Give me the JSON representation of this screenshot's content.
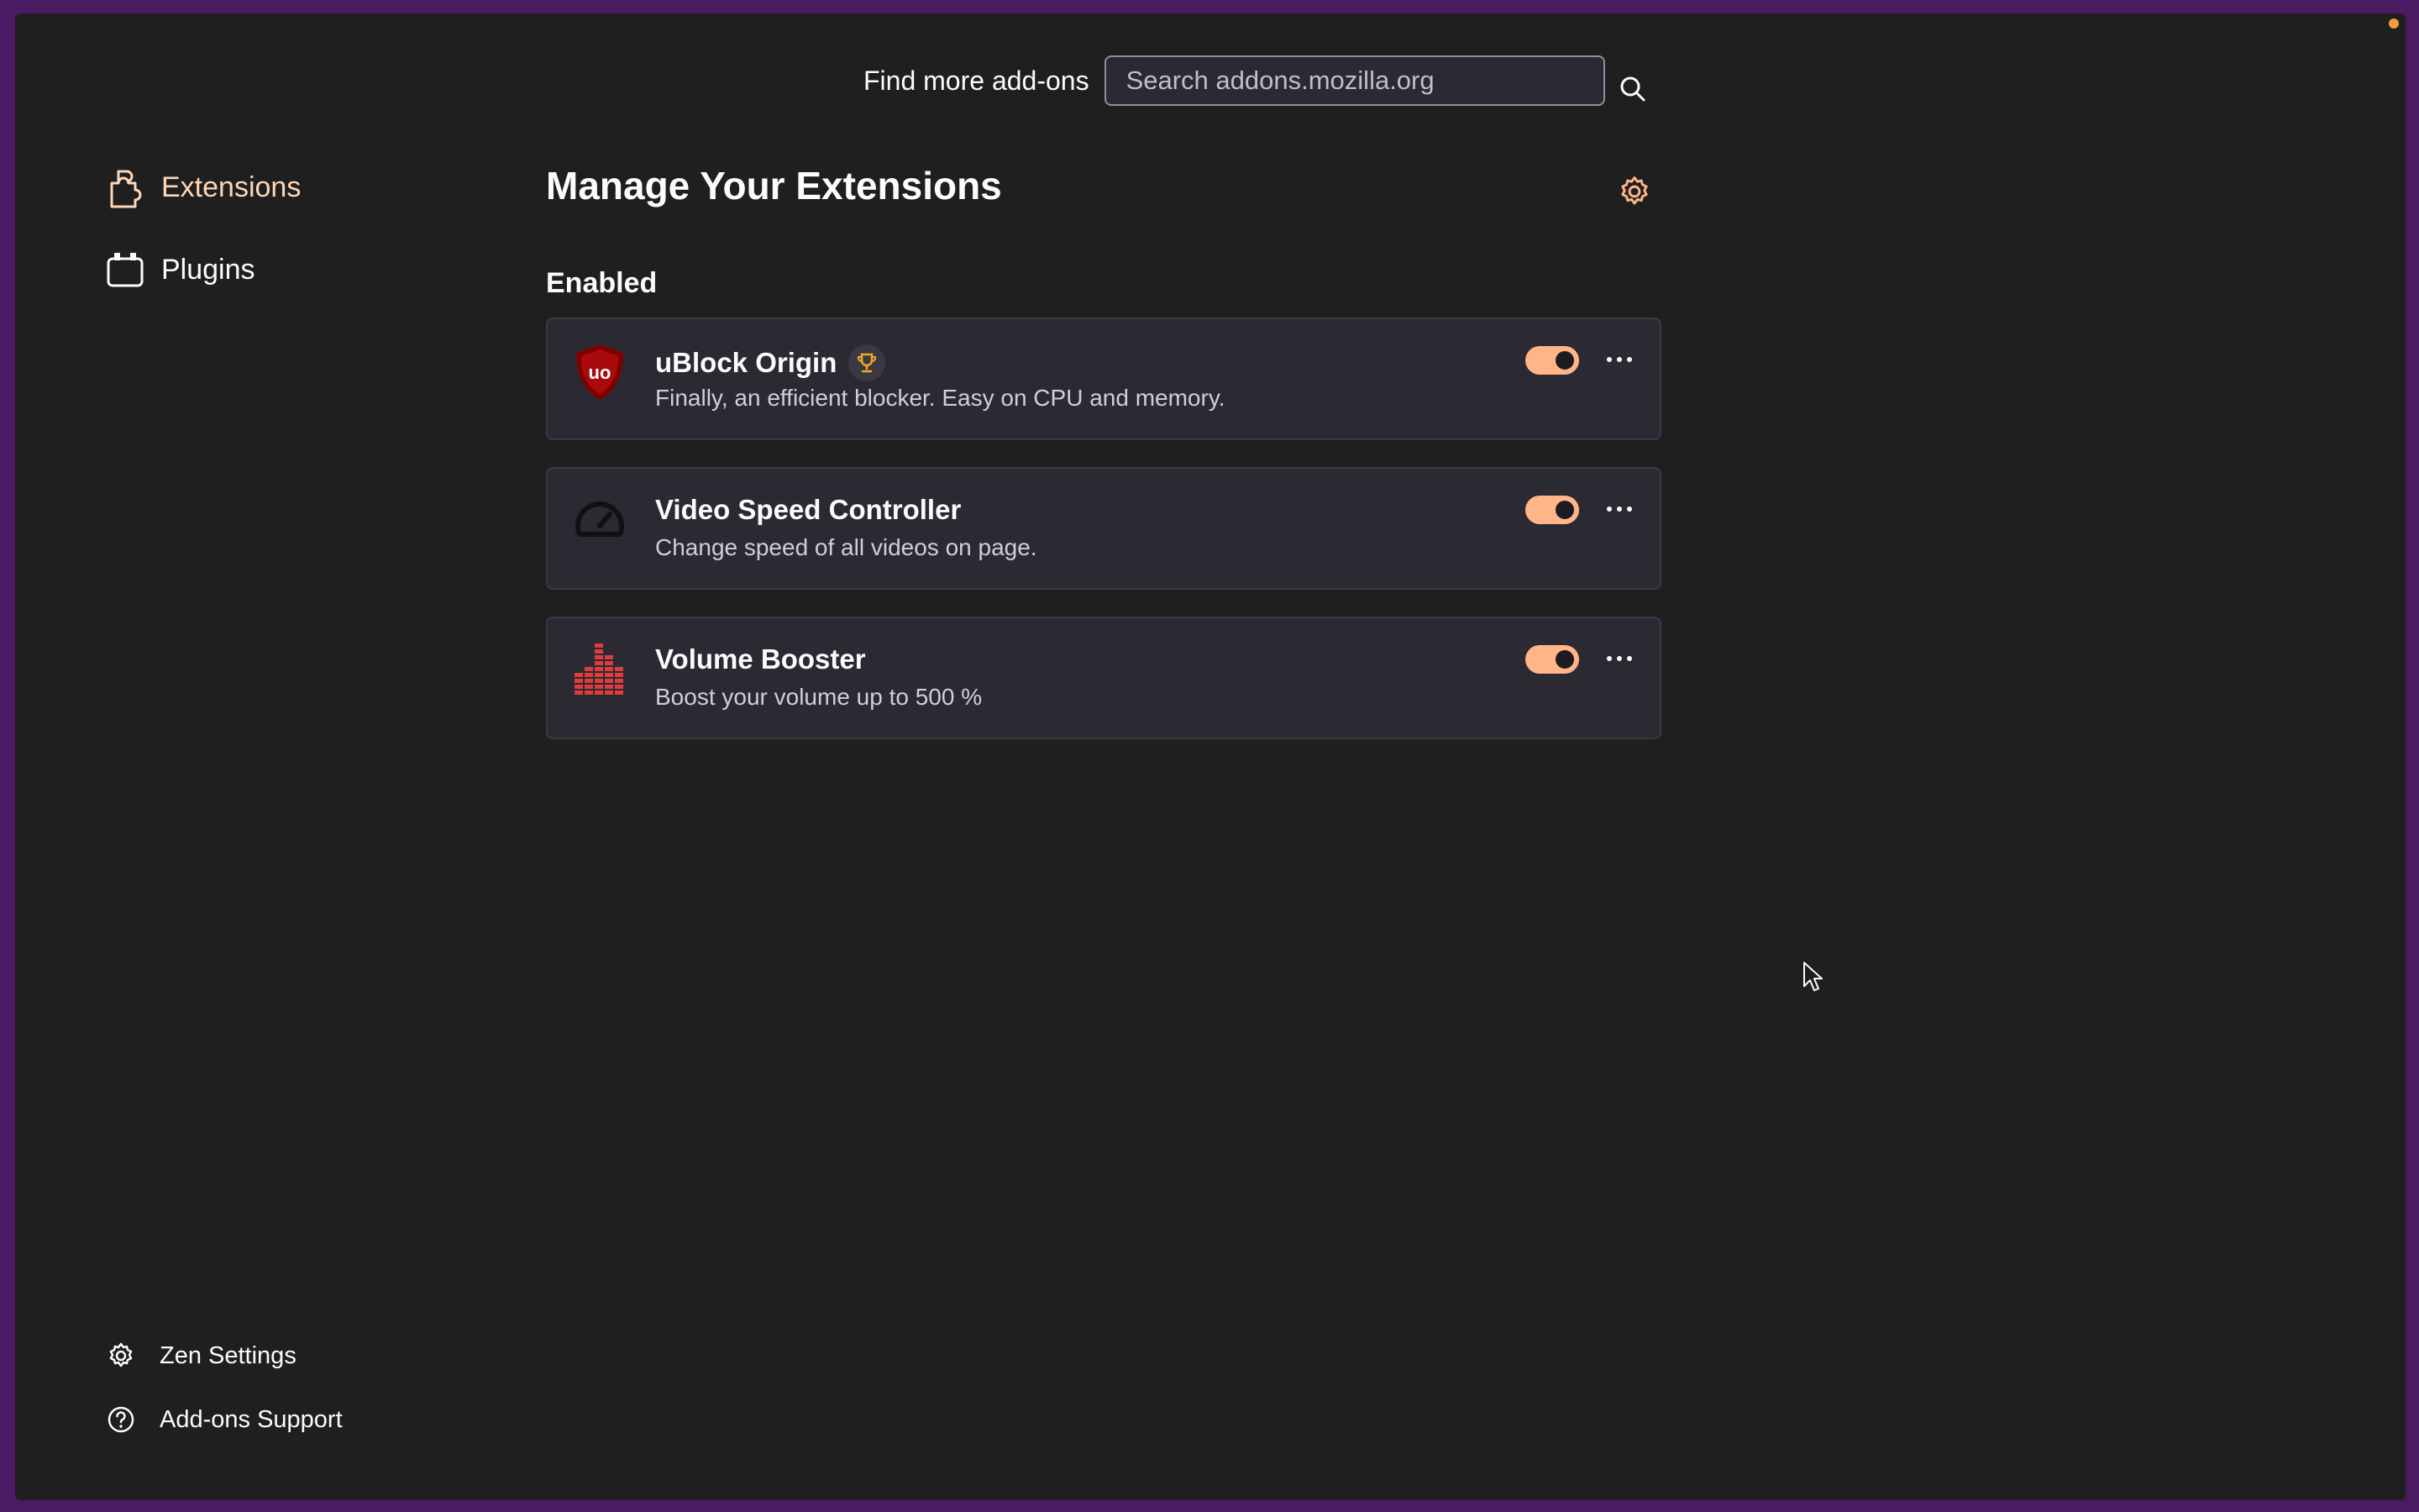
{
  "header": {
    "find_label": "Find more add-ons",
    "search_placeholder": "Search addons.mozilla.org"
  },
  "sidebar": {
    "items": [
      {
        "label": "Extensions",
        "icon": "puzzle-icon",
        "selected": true
      },
      {
        "label": "Plugins",
        "icon": "plugin-icon",
        "selected": false
      }
    ],
    "footer": [
      {
        "label": "Zen Settings",
        "icon": "gear-icon"
      },
      {
        "label": "Add-ons Support",
        "icon": "help-icon"
      }
    ]
  },
  "main": {
    "title": "Manage Your Extensions",
    "section": "Enabled",
    "extensions": [
      {
        "name": "uBlock Origin",
        "description": "Finally, an efficient blocker. Easy on CPU and memory.",
        "enabled": true,
        "recommended_badge": true,
        "icon": "ublock-shield-icon"
      },
      {
        "name": "Video Speed Controller",
        "description": "Change speed of all videos on page.",
        "enabled": true,
        "recommended_badge": false,
        "icon": "speedometer-icon"
      },
      {
        "name": "Volume Booster",
        "description": "Boost your volume up to 500 %",
        "enabled": true,
        "recommended_badge": false,
        "icon": "equalizer-icon"
      }
    ]
  },
  "colors": {
    "accent": "#ffb587",
    "background": "#1f1f1f",
    "card": "#2b2a33",
    "frame": "#4a1a63"
  }
}
